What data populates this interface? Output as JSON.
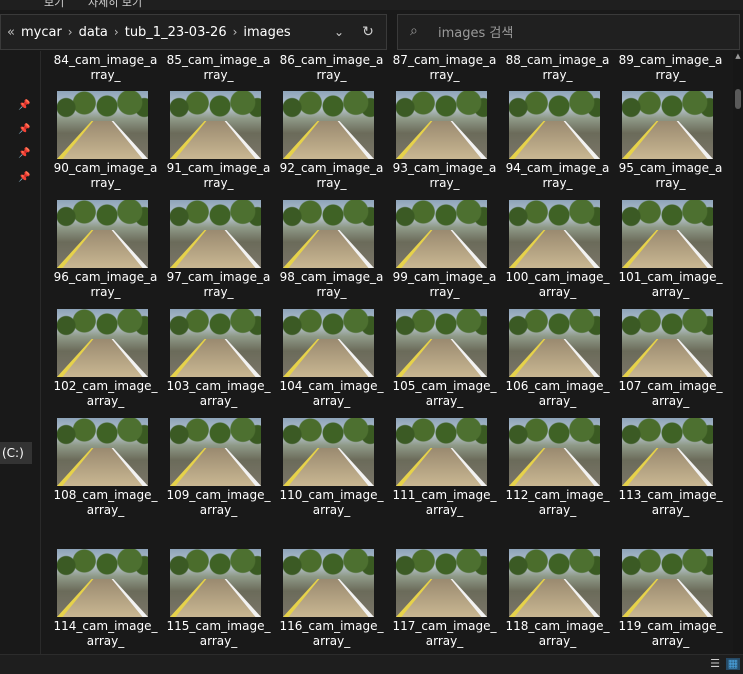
{
  "window": {
    "tab_fragment_1": "보기",
    "tab_fragment_2": "자세히 보기"
  },
  "address": {
    "back_glyph": "«",
    "crumbs": [
      "mycar",
      "data",
      "tub_1_23-03-26",
      "images"
    ]
  },
  "search": {
    "placeholder": "images 검색"
  },
  "nav": {
    "drive_label": "(C:)"
  },
  "files": {
    "labels": [
      [
        "84_cam_image_a",
        "rray_"
      ],
      [
        "85_cam_image_a",
        "rray_"
      ],
      [
        "86_cam_image_a",
        "rray_"
      ],
      [
        "87_cam_image_a",
        "rray_"
      ],
      [
        "88_cam_image_a",
        "rray_"
      ],
      [
        "89_cam_image_a",
        "rray_"
      ],
      [
        "90_cam_image_a",
        "rray_"
      ],
      [
        "91_cam_image_a",
        "rray_"
      ],
      [
        "92_cam_image_a",
        "rray_"
      ],
      [
        "93_cam_image_a",
        "rray_"
      ],
      [
        "94_cam_image_a",
        "rray_"
      ],
      [
        "95_cam_image_a",
        "rray_"
      ],
      [
        "96_cam_image_a",
        "rray_"
      ],
      [
        "97_cam_image_a",
        "rray_"
      ],
      [
        "98_cam_image_a",
        "rray_"
      ],
      [
        "99_cam_image_a",
        "rray_"
      ],
      [
        "100_cam_image_",
        "array_"
      ],
      [
        "101_cam_image_",
        "array_"
      ],
      [
        "102_cam_image_",
        "array_"
      ],
      [
        "103_cam_image_",
        "array_"
      ],
      [
        "104_cam_image_",
        "array_"
      ],
      [
        "105_cam_image_",
        "array_"
      ],
      [
        "106_cam_image_",
        "array_"
      ],
      [
        "107_cam_image_",
        "array_"
      ],
      [
        "108_cam_image_",
        "array_"
      ],
      [
        "109_cam_image_",
        "array_"
      ],
      [
        "110_cam_image_",
        "array_"
      ],
      [
        "111_cam_image_",
        "array_"
      ],
      [
        "112_cam_image_",
        "array_"
      ],
      [
        "113_cam_image_",
        "array_"
      ],
      [
        "114_cam_image_",
        "array_"
      ],
      [
        "115_cam_image_",
        "array_"
      ],
      [
        "116_cam_image_",
        "array_"
      ],
      [
        "117_cam_image_",
        "array_"
      ],
      [
        "118_cam_image_",
        "array_"
      ],
      [
        "119_cam_image_",
        "array_"
      ]
    ]
  },
  "icons": {
    "search": "search-icon",
    "pin": "pin-icon",
    "refresh": "refresh-icon",
    "dropdown": "chevron-down-icon",
    "details_view": "details-view-icon",
    "thumbnail_view": "large-icons-view-icon"
  },
  "colors": {
    "background": "#191919",
    "text": "#ffffff",
    "accent": "#4aa3df"
  }
}
